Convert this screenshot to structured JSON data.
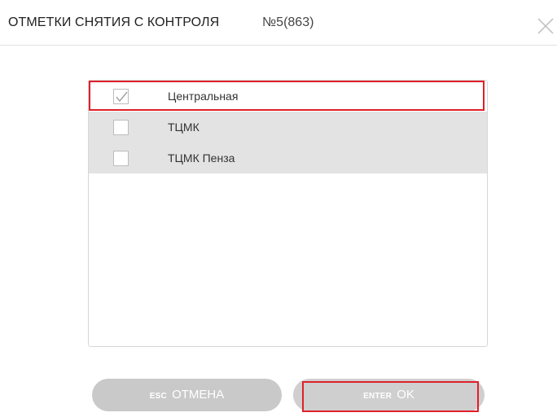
{
  "dialog": {
    "title": "ОТМЕТКИ СНЯТИЯ С КОНТРОЛЯ",
    "number": "№5(863)",
    "close_icon": "close-icon"
  },
  "list": {
    "items": [
      {
        "label": "Центральная",
        "checked": true
      },
      {
        "label": "ТЦМК",
        "checked": false
      },
      {
        "label": "ТЦМК Пенза",
        "checked": false
      }
    ]
  },
  "buttons": {
    "cancel_key": "ESC",
    "cancel_label": "ОТМЕНА",
    "ok_key": "ENTER",
    "ok_label": "OK"
  },
  "colors": {
    "highlight": "#e0202a",
    "row_unselected": "#e3e3e3",
    "button_bg": "#c9c9c9"
  }
}
